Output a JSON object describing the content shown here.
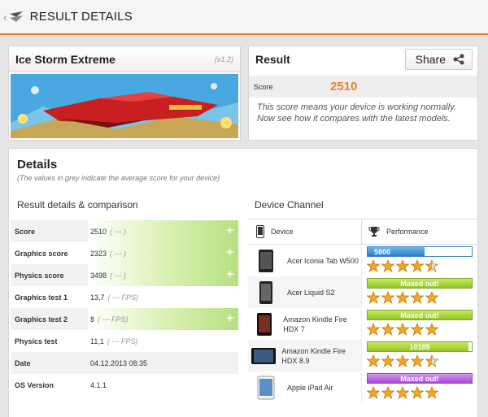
{
  "header": {
    "title": "RESULT DETAILS"
  },
  "test": {
    "name": "Ice Storm Extreme",
    "version": "(v1.2)"
  },
  "result": {
    "title": "Result",
    "share_label": "Share",
    "score_label": "Score",
    "score_value": "2510",
    "message": "This score means your device is working normally. Now see how it compares with the latest models."
  },
  "details": {
    "title": "Details",
    "subtitle": "(The values in grey indicate the average score for your device)",
    "left_title": "Result details & comparison",
    "right_title": "Device Channel",
    "rows": [
      {
        "label": "Score",
        "value": "2510",
        "avg": "( --- )"
      },
      {
        "label": "Graphics score",
        "value": "2323",
        "avg": "( --- )"
      },
      {
        "label": "Physics score",
        "value": "3498",
        "avg": "( --- )"
      },
      {
        "label": "Graphics test 1",
        "value": "13,7",
        "avg": "( --- FPS)"
      },
      {
        "label": "Graphics test 2",
        "value": "8",
        "avg": "( --- FPS)"
      },
      {
        "label": "Physics test",
        "value": "11,1",
        "avg": "( --- FPS)"
      },
      {
        "label": "Date",
        "value": "04.12.2013 08:35",
        "avg": ""
      },
      {
        "label": "OS Version",
        "value": "4.1.1",
        "avg": ""
      }
    ],
    "device_col": "Device",
    "perf_col": "Performance",
    "devices": [
      {
        "name": "Acer Iconia Tab W500",
        "bar_text": "5800",
        "bar_fraction": 0.55,
        "bar_color": "#2b7fc4",
        "stars": 4.5
      },
      {
        "name": "Acer Liquid S2",
        "bar_text": "Maxed out!",
        "bar_fraction": 1.0,
        "bar_color": "#95c428",
        "stars": 5
      },
      {
        "name": "Amazon Kindle Fire HDX 7",
        "bar_text": "Maxed out!",
        "bar_fraction": 1.0,
        "bar_color": "#95c428",
        "stars": 5
      },
      {
        "name": "Amazon Kindle Fire HDX 8.9",
        "bar_text": "10189",
        "bar_fraction": 0.97,
        "bar_color": "#95c428",
        "stars": 4.5
      },
      {
        "name": "Apple iPad Air",
        "bar_text": "Maxed out!",
        "bar_fraction": 1.0,
        "bar_color": "#a64dd2",
        "stars": 5
      }
    ]
  }
}
